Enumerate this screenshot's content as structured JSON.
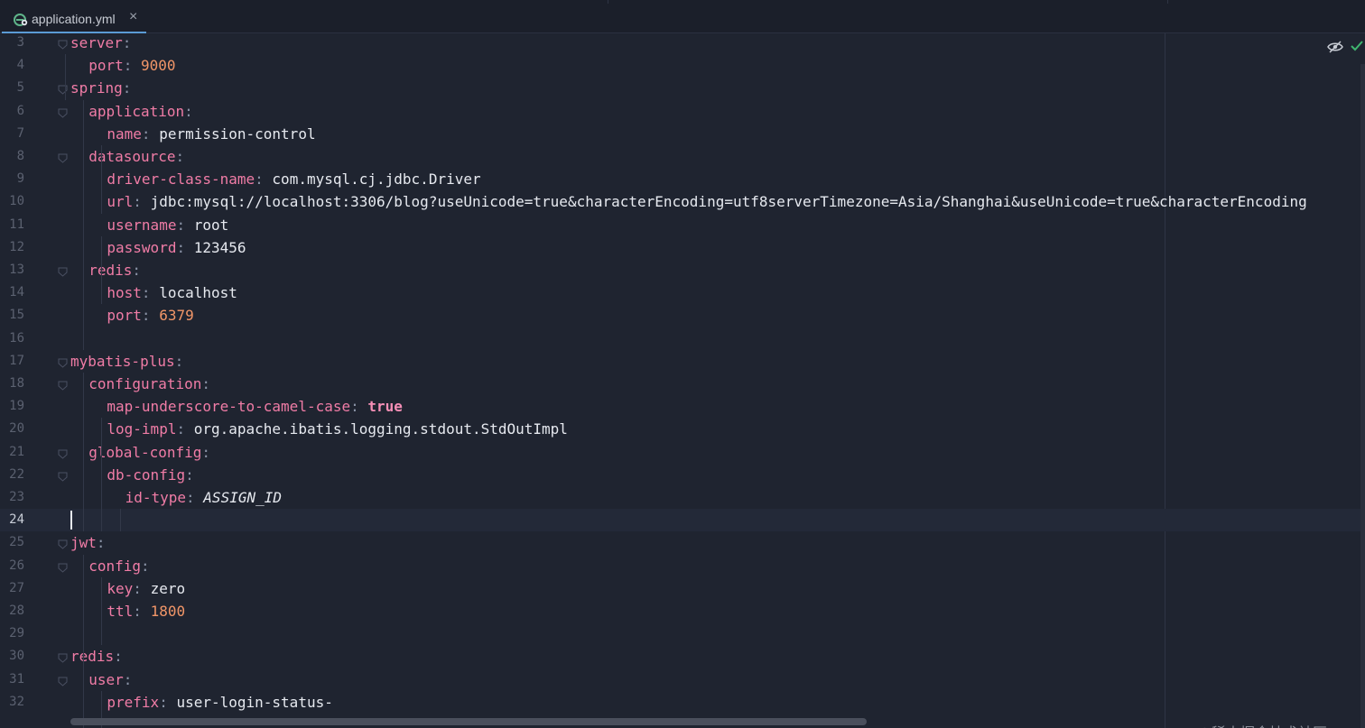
{
  "tab": {
    "title": "application.yml",
    "close_glyph": "×",
    "icon": "yaml-file-icon"
  },
  "editor": {
    "current_line": "24",
    "lines": [
      {
        "n": "3",
        "indent": 0,
        "key": "server"
      },
      {
        "n": "4",
        "indent": 1,
        "key": "port",
        "value": "9000",
        "kind": "num"
      },
      {
        "n": "5",
        "indent": 0,
        "key": "spring"
      },
      {
        "n": "6",
        "indent": 1,
        "key": "application"
      },
      {
        "n": "7",
        "indent": 2,
        "key": "name",
        "value": "permission-control",
        "kind": "str"
      },
      {
        "n": "8",
        "indent": 1,
        "key": "datasource"
      },
      {
        "n": "9",
        "indent": 2,
        "key": "driver-class-name",
        "value": "com.mysql.cj.jdbc.Driver",
        "kind": "str"
      },
      {
        "n": "10",
        "indent": 2,
        "key": "url",
        "value": "jdbc:mysql://localhost:3306/blog?useUnicode=true&characterEncoding=utf8serverTimezone=Asia/Shanghai&useUnicode=true&characterEncoding",
        "kind": "str"
      },
      {
        "n": "11",
        "indent": 2,
        "key": "username",
        "value": "root",
        "kind": "str"
      },
      {
        "n": "12",
        "indent": 2,
        "key": "password",
        "value": "123456",
        "kind": "str"
      },
      {
        "n": "13",
        "indent": 1,
        "key": "redis"
      },
      {
        "n": "14",
        "indent": 2,
        "key": "host",
        "value": "localhost",
        "kind": "str"
      },
      {
        "n": "15",
        "indent": 2,
        "key": "port",
        "value": "6379",
        "kind": "num"
      },
      {
        "n": "16"
      },
      {
        "n": "17",
        "indent": 0,
        "key": "mybatis-plus"
      },
      {
        "n": "18",
        "indent": 1,
        "key": "configuration"
      },
      {
        "n": "19",
        "indent": 2,
        "key": "map-underscore-to-camel-case",
        "value": "true",
        "kind": "bool"
      },
      {
        "n": "20",
        "indent": 2,
        "key": "log-impl",
        "value": "org.apache.ibatis.logging.stdout.StdOutImpl",
        "kind": "str"
      },
      {
        "n": "21",
        "indent": 1,
        "key": "global-config"
      },
      {
        "n": "22",
        "indent": 2,
        "key": "db-config"
      },
      {
        "n": "23",
        "indent": 3,
        "key": "id-type",
        "value": "ASSIGN_ID",
        "kind": "ital"
      },
      {
        "n": "24"
      },
      {
        "n": "25",
        "indent": 0,
        "key": "jwt"
      },
      {
        "n": "26",
        "indent": 1,
        "key": "config"
      },
      {
        "n": "27",
        "indent": 2,
        "key": "key",
        "value": "zero",
        "kind": "str"
      },
      {
        "n": "28",
        "indent": 2,
        "key": "ttl",
        "value": "1800",
        "kind": "num"
      },
      {
        "n": "29"
      },
      {
        "n": "30",
        "indent": 0,
        "key": "redis"
      },
      {
        "n": "31",
        "indent": 1,
        "key": "user"
      },
      {
        "n": "32",
        "indent": 2,
        "key": "prefix",
        "value": "user-login-status-",
        "kind": "str"
      }
    ]
  },
  "inspection": {
    "icons": [
      "eye-slash-icon",
      "check-icon"
    ],
    "check_color": "#3fb56f"
  },
  "colors": {
    "background": "#1f2430",
    "key": "#f07ca6",
    "number": "#f29668",
    "accent": "#5b9bd5"
  },
  "watermark": "@稀土掘金技术社区"
}
